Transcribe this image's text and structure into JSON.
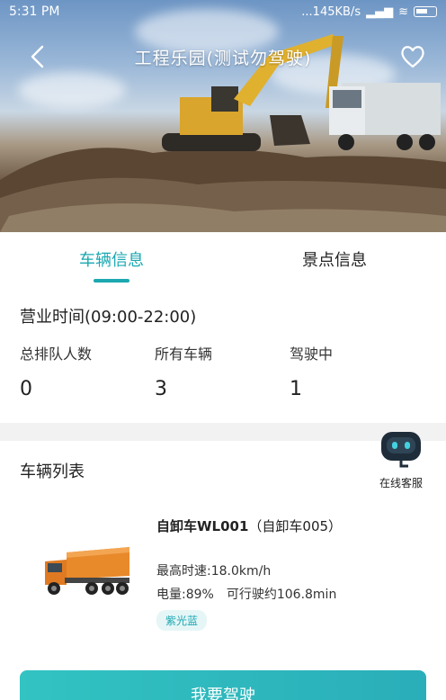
{
  "status_bar": {
    "time": "5:31 PM",
    "network_speed": "...145KB/s"
  },
  "header": {
    "title": "工程乐园(测试勿驾驶)"
  },
  "tabs": [
    {
      "label": "车辆信息",
      "active": true
    },
    {
      "label": "景点信息",
      "active": false
    }
  ],
  "hours": "营业时间(09:00-22:00)",
  "stats": [
    {
      "label": "总排队人数",
      "value": "0"
    },
    {
      "label": "所有车辆",
      "value": "3"
    },
    {
      "label": "驾驶中",
      "value": "1"
    }
  ],
  "vehicle_list": {
    "title": "车辆列表",
    "items": [
      {
        "name": "自卸车WL001",
        "model": "（自卸车005）",
        "max_speed": "最高时速:18.0km/h",
        "battery": "电量:89%",
        "range": "可行驶约106.8min",
        "color_tag": "紫光蓝"
      }
    ]
  },
  "customer_service": {
    "label": "在线客服"
  },
  "action_button": {
    "label": "我要驾驶"
  },
  "colors": {
    "accent": "#1ba8b1",
    "button_start": "#32c3c2",
    "button_end": "#2aaeb9"
  },
  "icons": [
    "back-icon",
    "heart-icon",
    "robot-service-icon",
    "truck-thumbnail"
  ]
}
